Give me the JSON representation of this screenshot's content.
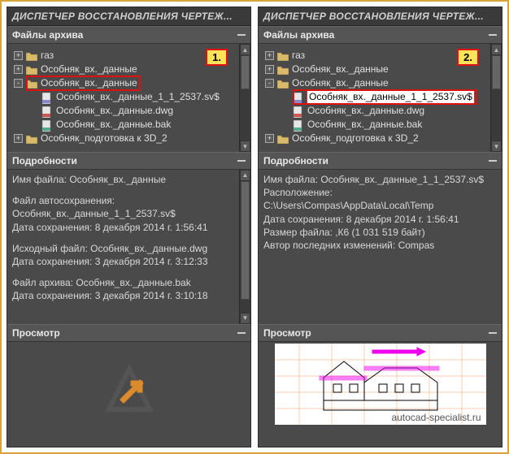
{
  "left": {
    "title": "ДИСПЕТЧЕР ВОССТАНОВЛЕНИЯ ЧЕРТЕЖ...",
    "badge": "1.",
    "headers": {
      "files": "Файлы архива",
      "details": "Подробности",
      "preview": "Просмотр"
    },
    "tree": [
      {
        "exp": "+",
        "icon": "folder",
        "label": "газ",
        "indent": 0
      },
      {
        "exp": "+",
        "icon": "folder",
        "label": "Особняк_вх._данные",
        "indent": 0
      },
      {
        "exp": "-",
        "icon": "folder",
        "label": "Особняк_вх._данные",
        "indent": 0,
        "boxed": true
      },
      {
        "icon": "file-sv",
        "label": "Особняк_вх._данные_1_1_2537.sv$",
        "indent": 2
      },
      {
        "icon": "file-dwg",
        "label": "Особняк_вх._данные.dwg",
        "indent": 2
      },
      {
        "icon": "file-bak",
        "label": "Особняк_вх._данные.bak",
        "indent": 2
      },
      {
        "exp": "+",
        "icon": "folder",
        "label": "Особняк_подготовка к 3D_2",
        "indent": 0
      }
    ],
    "details": {
      "file_label": "Имя файла:",
      "file_name": "Особняк_вх._данные",
      "autosave_label": "Файл автосохранения:",
      "autosave_name": "Особняк_вх._данные_1_1_2537.sv$",
      "autosave_date_label": "Дата сохранения:",
      "autosave_date": "8 декабря 2014 г.  1:56:41",
      "src_label": "Исходный файл:",
      "src_name": "Особняк_вх._данные.dwg",
      "src_date_label": "Дата сохранения:",
      "src_date": "3 декабря 2014 г.  3:12:33",
      "bak_label": "Файл архива:",
      "bak_name": "Особняк_вх._данные.bak",
      "bak_date_label": "Дата сохранения:",
      "bak_date": "3 декабря 2014 г.  3:10:18"
    }
  },
  "right": {
    "title": "ДИСПЕТЧЕР ВОССТАНОВЛЕНИЯ ЧЕРТЕЖ...",
    "badge": "2.",
    "headers": {
      "files": "Файлы архива",
      "details": "Подробности",
      "preview": "Просмотр"
    },
    "tree": [
      {
        "exp": "+",
        "icon": "folder",
        "label": "газ",
        "indent": 0
      },
      {
        "exp": "+",
        "icon": "folder",
        "label": "Особняк_вх._данные",
        "indent": 0
      },
      {
        "exp": "-",
        "icon": "folder",
        "label": "Особняк_вх._данные",
        "indent": 0
      },
      {
        "icon": "file-sv",
        "label": "Особняк_вх._данные_1_1_2537.sv$",
        "indent": 2,
        "selected": true,
        "boxed": true
      },
      {
        "icon": "file-dwg",
        "label": "Особняк_вх._данные.dwg",
        "indent": 2
      },
      {
        "icon": "file-bak",
        "label": "Особняк_вх._данные.bak",
        "indent": 2
      },
      {
        "exp": "+",
        "icon": "folder",
        "label": "Особняк_подготовка к 3D_2",
        "indent": 0
      }
    ],
    "details": {
      "file_label": "Имя файла:",
      "file_name": "Особняк_вх._данные_1_1_2537.sv$",
      "loc_label": "Расположение:",
      "loc_value": "C:\\Users\\Compas\\AppData\\Local\\Temp",
      "date_label": "Дата сохранения:",
      "date_value": "8 декабря 2014 г.  1:56:41",
      "size_label": "Размер файла:",
      "size_value": ",К6 (1 031 519 байт)",
      "author_label": "Автор последних изменений:",
      "author_value": "Compas"
    },
    "preview_watermark": "autocad-specialist.ru"
  }
}
